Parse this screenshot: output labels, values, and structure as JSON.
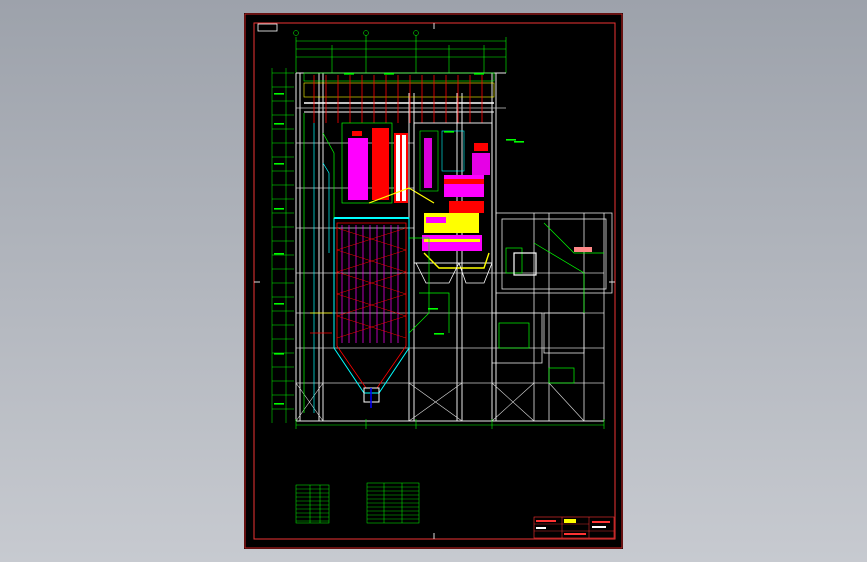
{
  "sheet": {
    "background": "#000000",
    "frame_color": "#ff2a2a",
    "corner_tag": "",
    "colors": {
      "green": "#00ff00",
      "cyan": "#00ffff",
      "red": "#ff0000",
      "magenta": "#ff00ff",
      "yellow": "#ffff00",
      "white": "#ffffff",
      "violet": "#cc88ff",
      "pink": "#ff88cc"
    }
  }
}
